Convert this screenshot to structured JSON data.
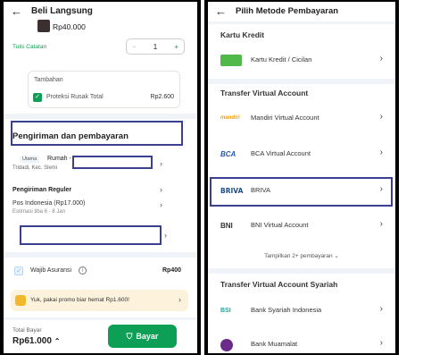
{
  "left": {
    "header": {
      "title": "Beli Langsung"
    },
    "product": {
      "price": "Rp40.000",
      "notes_link": "Tulis Catatan",
      "quantity": "1",
      "minus": "−",
      "plus": "+"
    },
    "tambahan": {
      "title": "Tambahan",
      "label": "Proteksi Rusak Total",
      "price": "Rp2.600"
    },
    "shipping_section": {
      "title": "Pengiriman dan pembayaran",
      "address_badge": "Utama",
      "address_name": "Rumah -",
      "address_line": "Tridadi, Kec. Slemi",
      "courier_title": "Pengiriman Reguler",
      "courier_service": "Pos Indonesia (Rp17.000)",
      "courier_eta": "Estimasi tiba 6 - 8 Jan"
    },
    "insurance": {
      "label": "Wajib Asuransi",
      "price": "Rp400"
    },
    "promo": {
      "text": "Yuk, pakai promo biar hemat Rp1.600!"
    },
    "footer": {
      "total_label": "Total Bayar",
      "total_value": "Rp61.000",
      "pay_label": "Bayar"
    }
  },
  "right": {
    "header": {
      "title": "Pilih Metode Pembayaran"
    },
    "sections": {
      "credit": "Kartu Kredit",
      "va": "Transfer Virtual Account",
      "va_syariah": "Transfer Virtual Account Syariah"
    },
    "methods": {
      "cc": {
        "logo": "",
        "label": "Kartu Kredit / Cicilan"
      },
      "mandiri": {
        "logo": "mandiri",
        "label": "Mandiri Virtual Account"
      },
      "bca": {
        "logo": "BCA",
        "label": "BCA Virtual Account"
      },
      "briva": {
        "logo": "BRIVA",
        "label": "BRIVA"
      },
      "bni": {
        "logo": "BNI",
        "label": "BNI Virtual Account"
      },
      "bsi": {
        "logo": "BSI",
        "label": "Bank Syariah Indonesia"
      },
      "muamalat": {
        "logo": "",
        "label": "Bank Muamalat"
      }
    },
    "show_more": "Tampilkan 2+ pembayaran"
  },
  "colors": {
    "accent": "#0c9f55",
    "highlight_border": "#3a3f8f"
  }
}
